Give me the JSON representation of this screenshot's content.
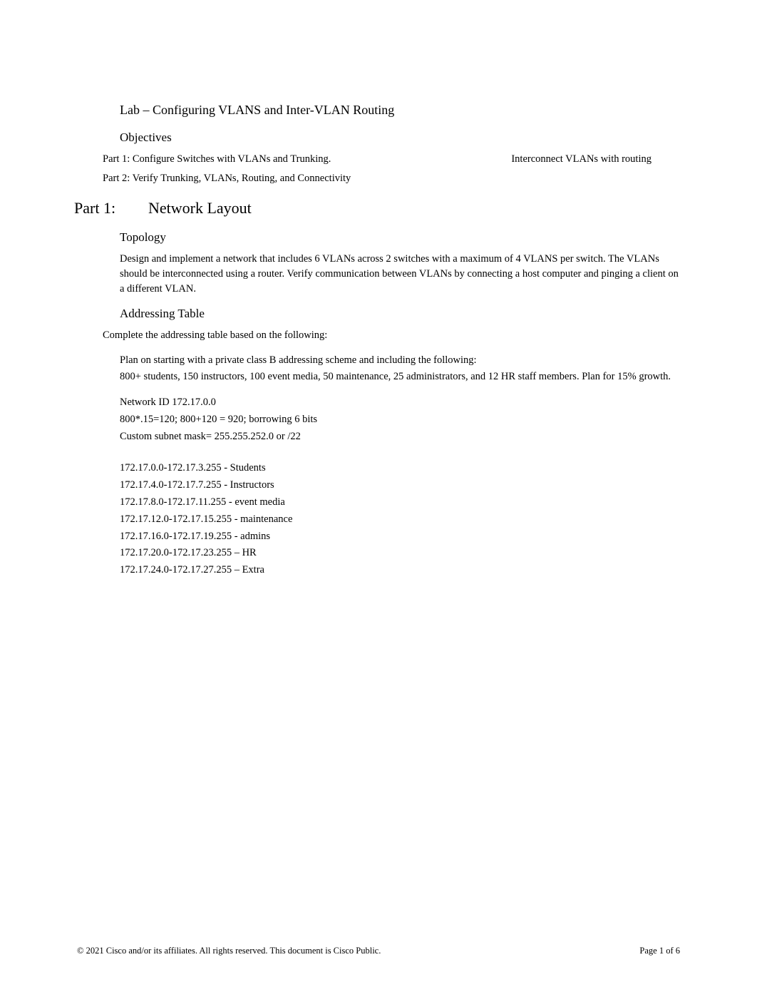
{
  "header": {
    "title": "Lab – Configuring VLANS and Inter-VLAN Routing",
    "objectives": "Objectives",
    "part1_left": "Part 1: Configure Switches with VLANs and Trunking.",
    "part1_right": "Interconnect VLANs with routing",
    "part2": "Part 2: Verify Trunking, VLANs, Routing, and Connectivity"
  },
  "part": {
    "label": "Part 1:",
    "title": "Network Layout"
  },
  "topology": {
    "heading": "Topology",
    "text": "Design and implement a network that includes 6 VLANs across 2 switches with a maximum of 4 VLANS per switch.    The VLANs should be interconnected using a router.        Verify communication between VLANs by connecting a host computer and pinging a client on a different VLAN."
  },
  "addressing": {
    "heading": "Addressing Table",
    "intro": "Complete the addressing table based on the following:",
    "plan": "Plan on starting with a private class B addressing scheme and including the following:",
    "members": "800+ students, 150 instructors, 100 event media, 50 maintenance, 25 administrators, and 12 HR staff members.    Plan for 15% growth.",
    "calc": [
      "Network ID 172.17.0.0",
      "800*.15=120; 800+120 = 920; borrowing 6 bits",
      "Custom subnet mask= 255.255.252.0 or /22"
    ],
    "subnets": [
      "172.17.0.0-172.17.3.255 - Students",
      "172.17.4.0-172.17.7.255 - Instructors",
      "172.17.8.0-172.17.11.255 - event media",
      "172.17.12.0-172.17.15.255 - maintenance",
      "172.17.16.0-172.17.19.255 - admins",
      "172.17.20.0-172.17.23.255 – HR",
      "172.17.24.0-172.17.27.255 – Extra"
    ]
  },
  "footer": {
    "left": "© 2021 Cisco and/or its affiliates. All rights reserved. This document is Cisco Public.",
    "right": "Page  1  of 6"
  }
}
